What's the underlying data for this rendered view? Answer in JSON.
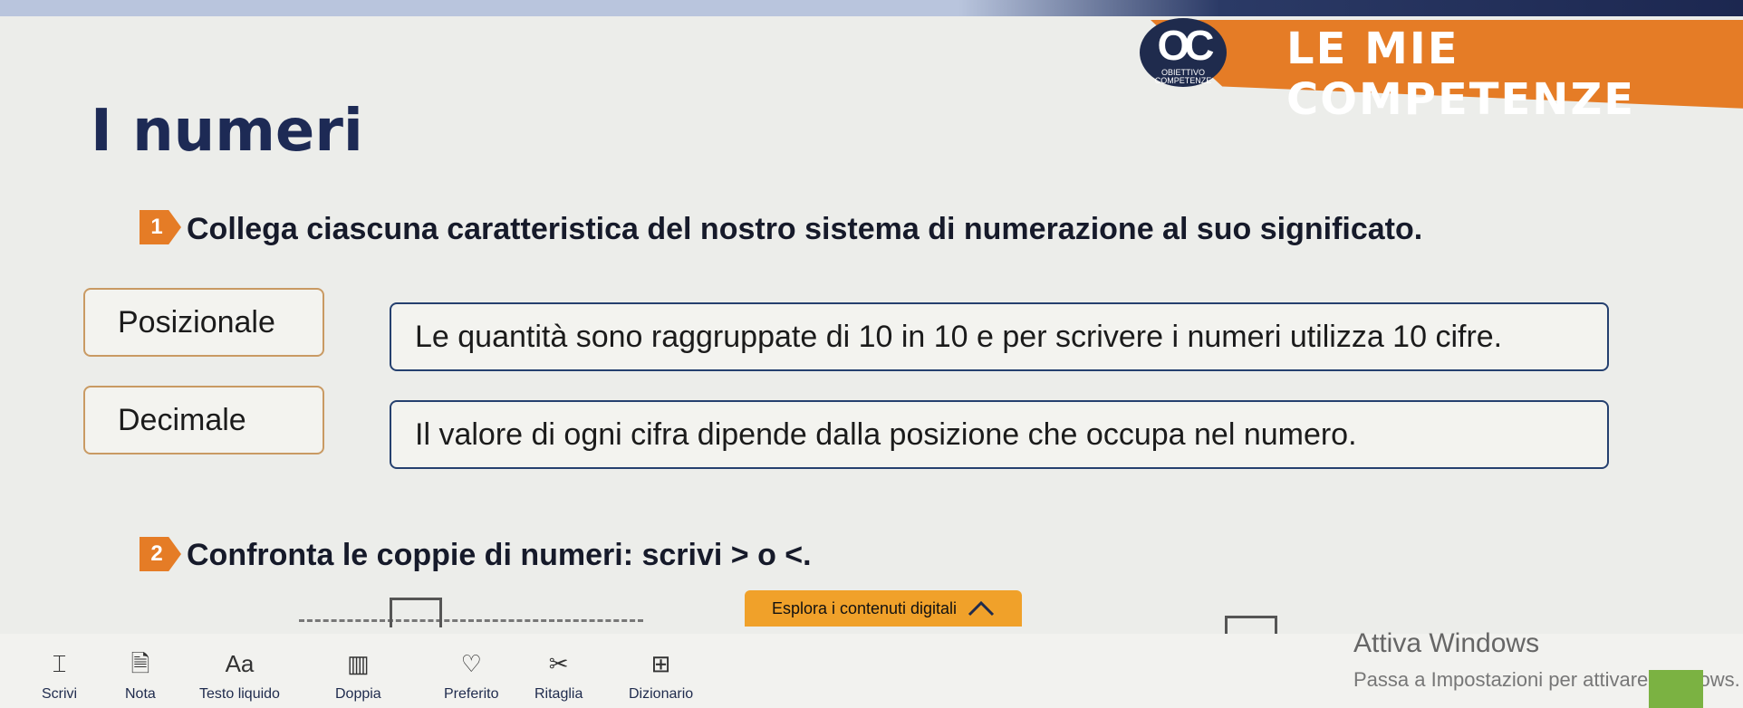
{
  "header": {
    "banner_title": "LE MIE COMPETENZE",
    "logo_text": "OC",
    "logo_small": "OBIETTIVO COMPETENZE"
  },
  "page_title": "I numeri",
  "exercise1": {
    "number": "1",
    "text": "Collega ciascuna caratteristica del nostro sistema di numerazione al suo significato.",
    "terms": [
      "Posizionale",
      "Decimale"
    ],
    "definitions": [
      "Le quantità sono raggruppate di 10 in 10 e per scrivere i numeri utilizza 10 cifre.",
      "Il valore di ogni cifra dipende dalla posizione che occupa nel numero."
    ]
  },
  "exercise2": {
    "number": "2",
    "text": "Confronta le coppie di numeri: scrivi > o <."
  },
  "digital_button": {
    "label": "Esplora i contenuti digitali",
    "icon": "chevron-up-icon"
  },
  "toolbar": [
    {
      "label": "Scrivi",
      "icon": "text-box-icon",
      "glyph": "⌶"
    },
    {
      "label": "Nota",
      "icon": "note-icon",
      "glyph": "🗎"
    },
    {
      "label": "Testo liquido",
      "icon": "font-size-icon",
      "glyph": "Aa"
    },
    {
      "label": "Doppia",
      "icon": "book-icon",
      "glyph": "▥"
    },
    {
      "label": "Preferito",
      "icon": "heart-icon",
      "glyph": "♡"
    },
    {
      "label": "Ritaglia",
      "icon": "scissors-icon",
      "glyph": "✂"
    },
    {
      "label": "Dizionario",
      "icon": "dictionary-icon",
      "glyph": "⊞"
    }
  ],
  "windows_watermark": {
    "title": "Attiva Windows",
    "subtitle": "Passa a Impostazioni per attivare Windows."
  },
  "colors": {
    "accent_orange": "#e57c26",
    "navy": "#1d2a55",
    "button_orange": "#f0a12a"
  }
}
